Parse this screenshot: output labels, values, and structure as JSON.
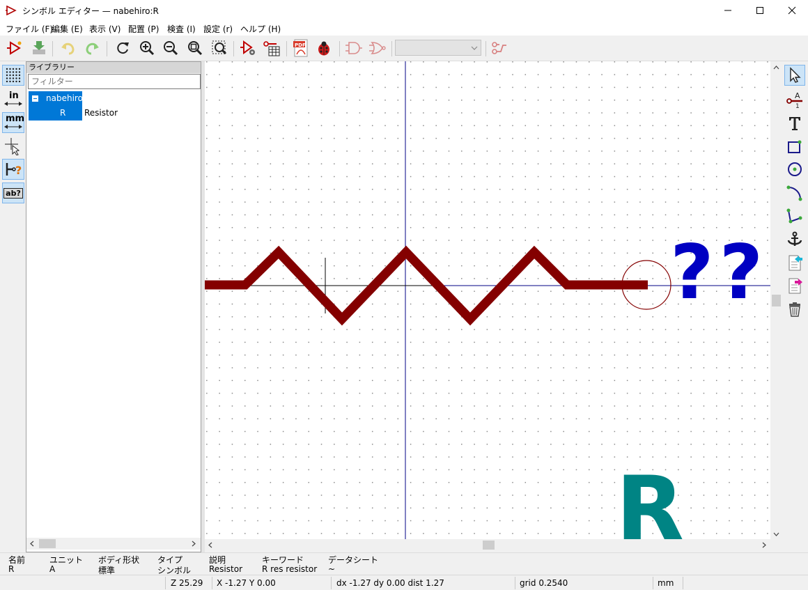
{
  "window": {
    "title": "シンボル エディター — nabehiro:R"
  },
  "menu": [
    {
      "label": "ファイル (F)"
    },
    {
      "label": "編集 (E)"
    },
    {
      "label": "表示 (V)"
    },
    {
      "label": "配置 (P)"
    },
    {
      "label": "検査 (I)"
    },
    {
      "label": "設定 (r)"
    },
    {
      "label": "ヘルプ (H)"
    }
  ],
  "toolbar": {
    "pdf_label": "PDF",
    "unit_combo_value": ""
  },
  "library_panel": {
    "header": "ライブラリー",
    "filter_placeholder": "フィルター",
    "library_name": "nabehiro",
    "symbol_name": "R",
    "symbol_description": "Resistor"
  },
  "left_toolbar": {
    "units_in": "in",
    "units_mm": "mm",
    "pin_names": "ab?"
  },
  "canvas": {
    "ref_field": "??",
    "value_field": "R",
    "colors": {
      "body": "#840000",
      "pin": "#840000",
      "reference": "#0000c2",
      "value": "#008484",
      "axis": "#000084"
    }
  },
  "symbol_info": {
    "headers": [
      "名前",
      "ユニット",
      "ボディ形状",
      "タイプ",
      "説明",
      "キーワード",
      "データシート"
    ],
    "values": [
      "R",
      "A",
      "標準",
      "シンボル",
      "Resistor",
      "R res resistor",
      "~"
    ]
  },
  "status": {
    "zoom": "Z 25.29",
    "cursor": "X -1.27  Y 0.00",
    "delta": "dx -1.27  dy 0.00  dist 1.27",
    "grid": "grid 0.2540",
    "units": "mm"
  }
}
